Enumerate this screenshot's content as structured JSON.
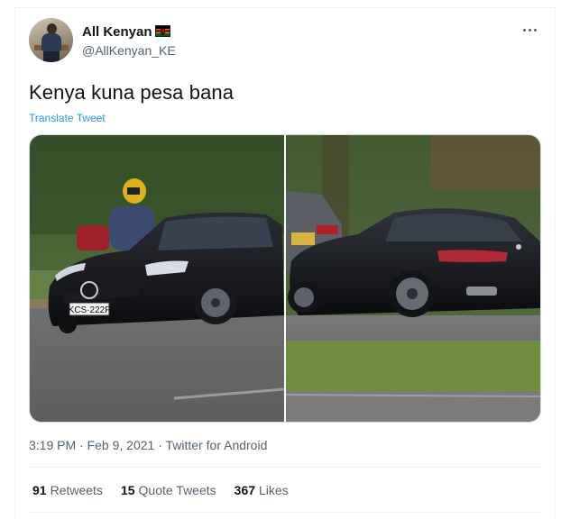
{
  "author": {
    "display_name": "All Kenyan",
    "flag_icon": "kenya-flag-icon",
    "handle": "@AllKenyan_KE"
  },
  "tweet": {
    "text": "Kenya kuna pesa bana",
    "translate_label": "Translate Tweet",
    "time": "3:19 PM",
    "date": "Feb 9, 2021",
    "source": "Twitter for Android",
    "separator": "·"
  },
  "media": {
    "plate_text": "KCS·222F"
  },
  "stats": {
    "retweets_count": "91",
    "retweets_label": "Retweets",
    "quotes_count": "15",
    "quotes_label": "Quote Tweets",
    "likes_count": "367",
    "likes_label": "Likes"
  },
  "colors": {
    "link": "#1d9bf0",
    "secondary_text": "#536471",
    "primary_text": "#0f1419"
  }
}
